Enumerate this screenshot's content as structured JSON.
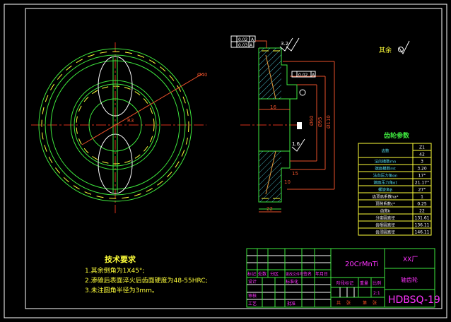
{
  "tech_requirements": {
    "title": "技术要求",
    "items": [
      "1.其余倒角为1X45°;",
      "2.渗碳后表面淬火后齿面硬度为48-55HRC;",
      "3.未注圆角半径为3mm。"
    ]
  },
  "roughness_note": "其余",
  "section_dims": {
    "d1": "22",
    "d2": "15",
    "d3": "10",
    "d4": "16",
    "roughness": "1.6",
    "roughness_top": "3.2",
    "runout1": "0.02",
    "runout2": "0.03",
    "runout3": "0.02",
    "datum": "A",
    "dia1": "Ø60",
    "dia2": "Ø95",
    "dia3": "Ø110"
  },
  "front_dims": {
    "radius": "R3",
    "dia": "Ø40"
  },
  "gear_params": {
    "title": "齿轮参数",
    "rows": [
      {
        "label": "齿数",
        "values": [
          "Z1",
          "42"
        ]
      },
      {
        "label": "法向模数mn",
        "values": [
          "3"
        ]
      },
      {
        "label": "端面模数mt",
        "values": [
          "3.20"
        ]
      },
      {
        "label": "法向压力角αn",
        "values": [
          "17°"
        ]
      },
      {
        "label": "端面压力角αt",
        "values": [
          "21.17°"
        ]
      },
      {
        "label": "螺旋角β",
        "values": [
          "27°"
        ]
      },
      {
        "label": "齿顶高系数ha*",
        "values": [
          "1"
        ]
      },
      {
        "label": "顶隙系数c*",
        "values": [
          "0.25"
        ]
      },
      {
        "label": "齿宽b",
        "values": [
          "22"
        ]
      },
      {
        "label": "分度圆直径",
        "values": [
          "131.61"
        ]
      },
      {
        "label": "齿根圆直径",
        "values": [
          "136.11"
        ]
      },
      {
        "label": "齿顶圆直径",
        "values": [
          "146.11"
        ]
      }
    ]
  },
  "title_block": {
    "material": "20CrMnTi",
    "company": "XX厂",
    "part_name": "轴齿轮",
    "drawing_no": "HDBSQ-19",
    "headers": [
      "标记",
      "处数",
      "分区",
      "更改文件号",
      "签名",
      "年月日"
    ],
    "design": "设计",
    "standard": "标准化",
    "check": "审核",
    "process": "工艺",
    "approve": "批准",
    "stage": "阶段标记",
    "weight": "重量",
    "scale_label": "比例",
    "scale": "2:1",
    "sheets": [
      "共",
      "张",
      "第",
      "张"
    ]
  }
}
